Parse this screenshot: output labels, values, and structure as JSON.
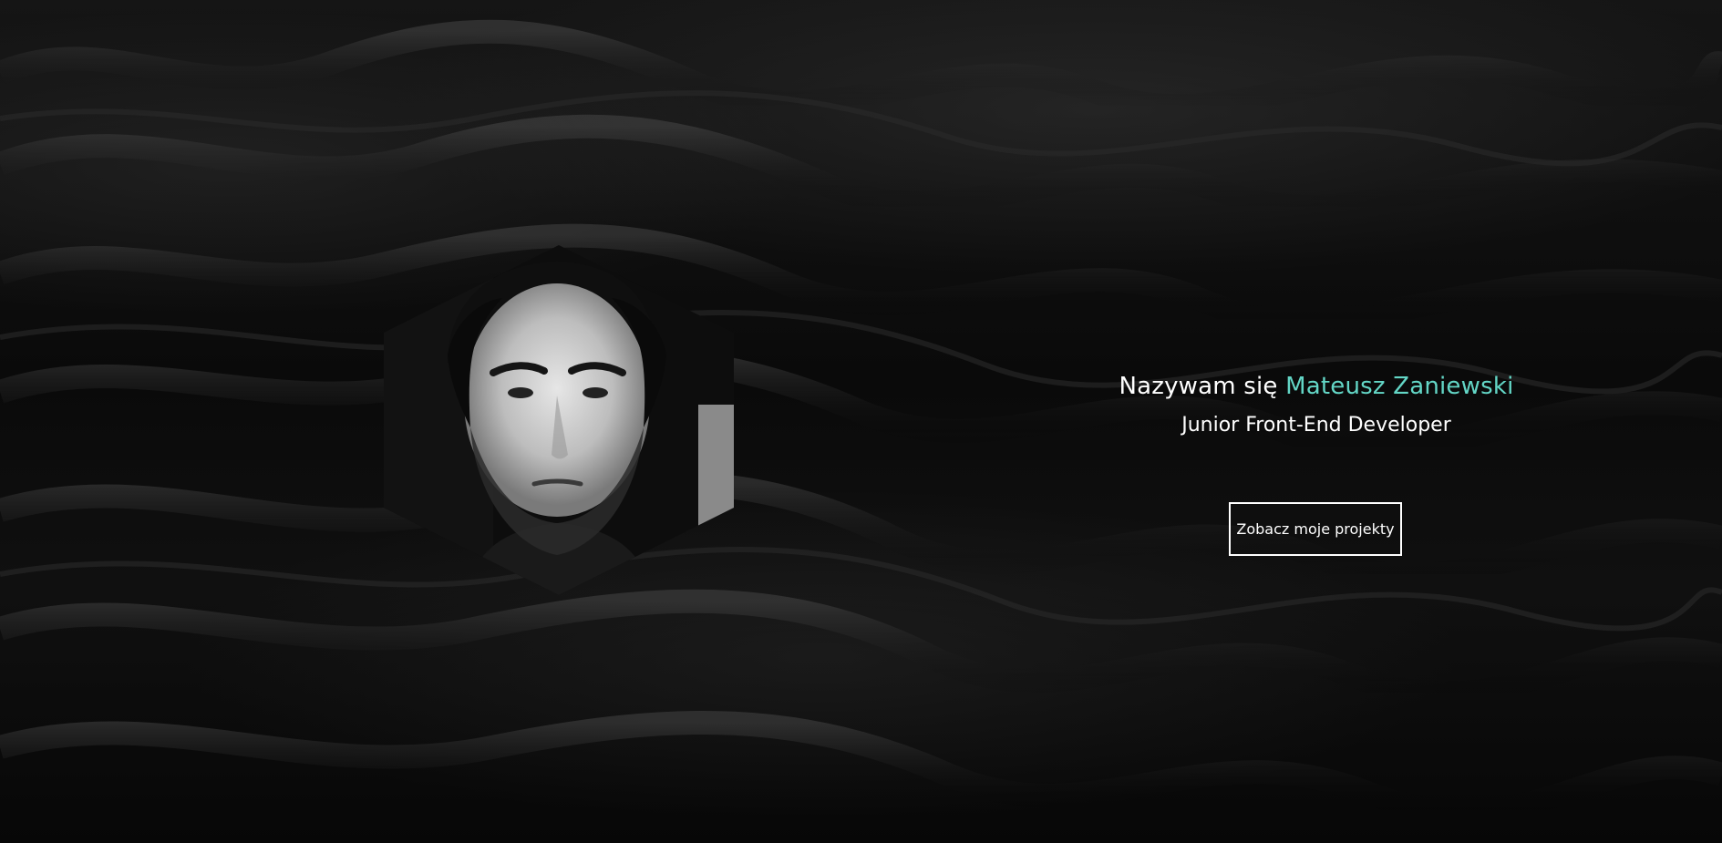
{
  "intro": {
    "greeting": "Nazywam się ",
    "name": "Mateusz Zaniewski",
    "role": "Junior Front-End Developer"
  },
  "cta": {
    "label": "Zobacz moje projekty"
  },
  "colors": {
    "accent": "#63d6c6",
    "text": "#ffffff",
    "background": "#0b0b0b"
  },
  "icons": {
    "portrait": "hexagon-portrait"
  }
}
